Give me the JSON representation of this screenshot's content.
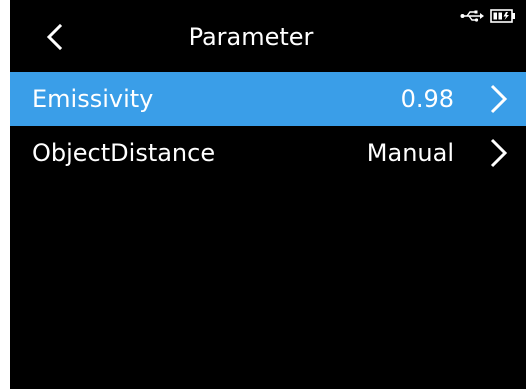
{
  "header": {
    "title": "Parameter",
    "back_icon": "chevron-left-icon",
    "status_icons": [
      "usb-icon",
      "battery-charging-icon"
    ]
  },
  "colors": {
    "accent": "#3a9ee8",
    "background": "#000000",
    "text": "#ffffff"
  },
  "list": {
    "items": [
      {
        "label": "Emissivity",
        "value": "0.98",
        "selected": true,
        "icon": "chevron-right-icon"
      },
      {
        "label": "ObjectDistance",
        "value": "Manual",
        "selected": false,
        "icon": "chevron-right-icon"
      }
    ]
  }
}
